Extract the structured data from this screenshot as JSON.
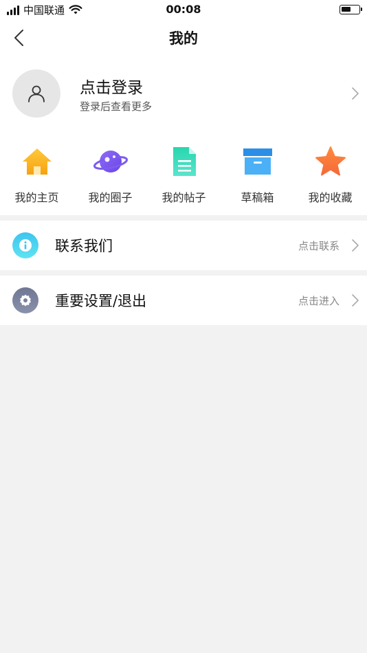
{
  "status_bar": {
    "carrier": "中国联通",
    "time": "00:08",
    "battery_level": 0.55
  },
  "nav": {
    "title": "我的"
  },
  "profile": {
    "title": "点击登录",
    "subtitle": "登录后查看更多"
  },
  "quick_actions": [
    {
      "label": "我的主页",
      "icon": "home-icon",
      "color": "#f7b21f"
    },
    {
      "label": "我的圈子",
      "icon": "planet-icon",
      "color": "#7b5cf0"
    },
    {
      "label": "我的帖子",
      "icon": "document-icon",
      "color": "#2fd3b4"
    },
    {
      "label": "草稿箱",
      "icon": "archive-box-icon",
      "color": "#3ba4f5"
    },
    {
      "label": "我的收藏",
      "icon": "star-icon",
      "color": "#f77a3b"
    }
  ],
  "menu": [
    {
      "label": "联系我们",
      "hint": "点击联系",
      "icon": "info-icon",
      "color": "#3fd0f0"
    },
    {
      "label": "重要设置/退出",
      "hint": "点击进入",
      "icon": "settings-gear-icon",
      "color": "#737a96"
    }
  ]
}
